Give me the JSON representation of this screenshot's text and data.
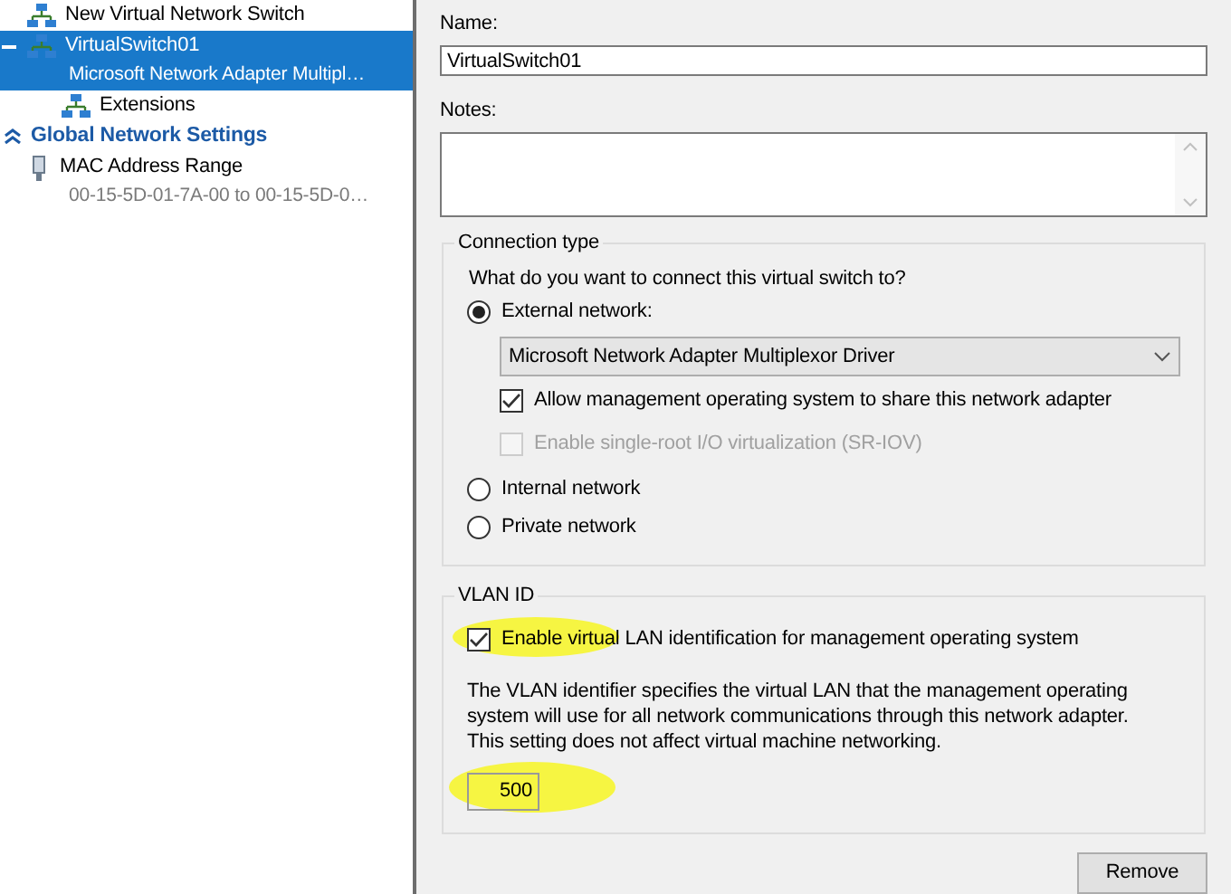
{
  "sidebar": {
    "items": [
      {
        "kind": "switch",
        "label": "New Virtual Network Switch",
        "selected": false
      },
      {
        "kind": "switch",
        "label": "VirtualSwitch01",
        "sublabel": "Microsoft Network Adapter Multipl…",
        "selected": true,
        "expanded": true
      },
      {
        "kind": "extension",
        "label": "Extensions",
        "selected": false
      },
      {
        "kind": "section",
        "label": "Global Network Settings",
        "selected": false
      },
      {
        "kind": "mac",
        "label": "MAC Address Range",
        "sublabel": "00-15-5D-01-7A-00 to 00-15-5D-0…",
        "selected": false
      }
    ]
  },
  "name": {
    "label": "Name:",
    "value": "VirtualSwitch01"
  },
  "notes": {
    "label": "Notes:"
  },
  "connection_type": {
    "title": "Connection type",
    "question": "What do you want to connect this virtual switch to?",
    "options": [
      {
        "label": "External network:",
        "selected": true
      },
      {
        "label": "Internal network",
        "selected": false
      },
      {
        "label": "Private network",
        "selected": false
      }
    ],
    "adapter": "Microsoft Network Adapter Multiplexor Driver",
    "checkboxes": [
      {
        "label": "Allow management operating system to share this network adapter",
        "checked": true,
        "disabled": false
      },
      {
        "label": "Enable single-root I/O virtualization (SR-IOV)",
        "checked": false,
        "disabled": true
      }
    ]
  },
  "vlan": {
    "title": "VLAN ID",
    "checkbox": {
      "label": "Enable virtual LAN identification for management operating system",
      "checked": true,
      "highlighted": true
    },
    "description": "The VLAN identifier specifies the virtual LAN that the management operating system will use for all network communications through this network adapter. This setting does not affect virtual machine networking.",
    "id_value": "500",
    "id_highlighted": true
  },
  "buttons": [
    "Remove"
  ]
}
